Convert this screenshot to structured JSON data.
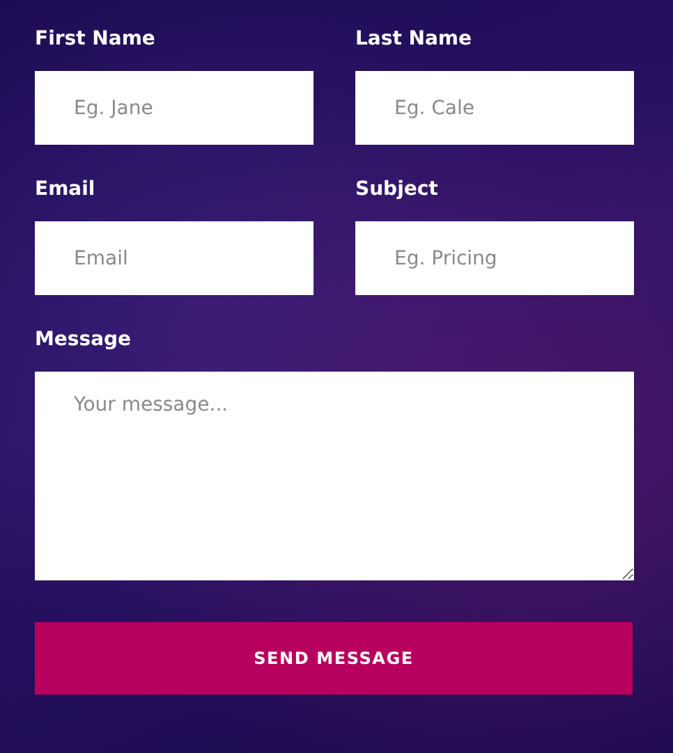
{
  "form": {
    "fields": [
      {
        "label": "First Name",
        "placeholder": "Eg. Jane",
        "kind": "text"
      },
      {
        "label": "Last Name",
        "placeholder": "Eg. Cale",
        "kind": "text"
      },
      {
        "label": "Email",
        "placeholder": "Email",
        "kind": "text"
      },
      {
        "label": "Subject",
        "placeholder": "Eg. Pricing",
        "kind": "text"
      },
      {
        "label": "Message",
        "placeholder": "Your message...",
        "kind": "textarea"
      }
    ],
    "submit": "SEND MESSAGE"
  }
}
